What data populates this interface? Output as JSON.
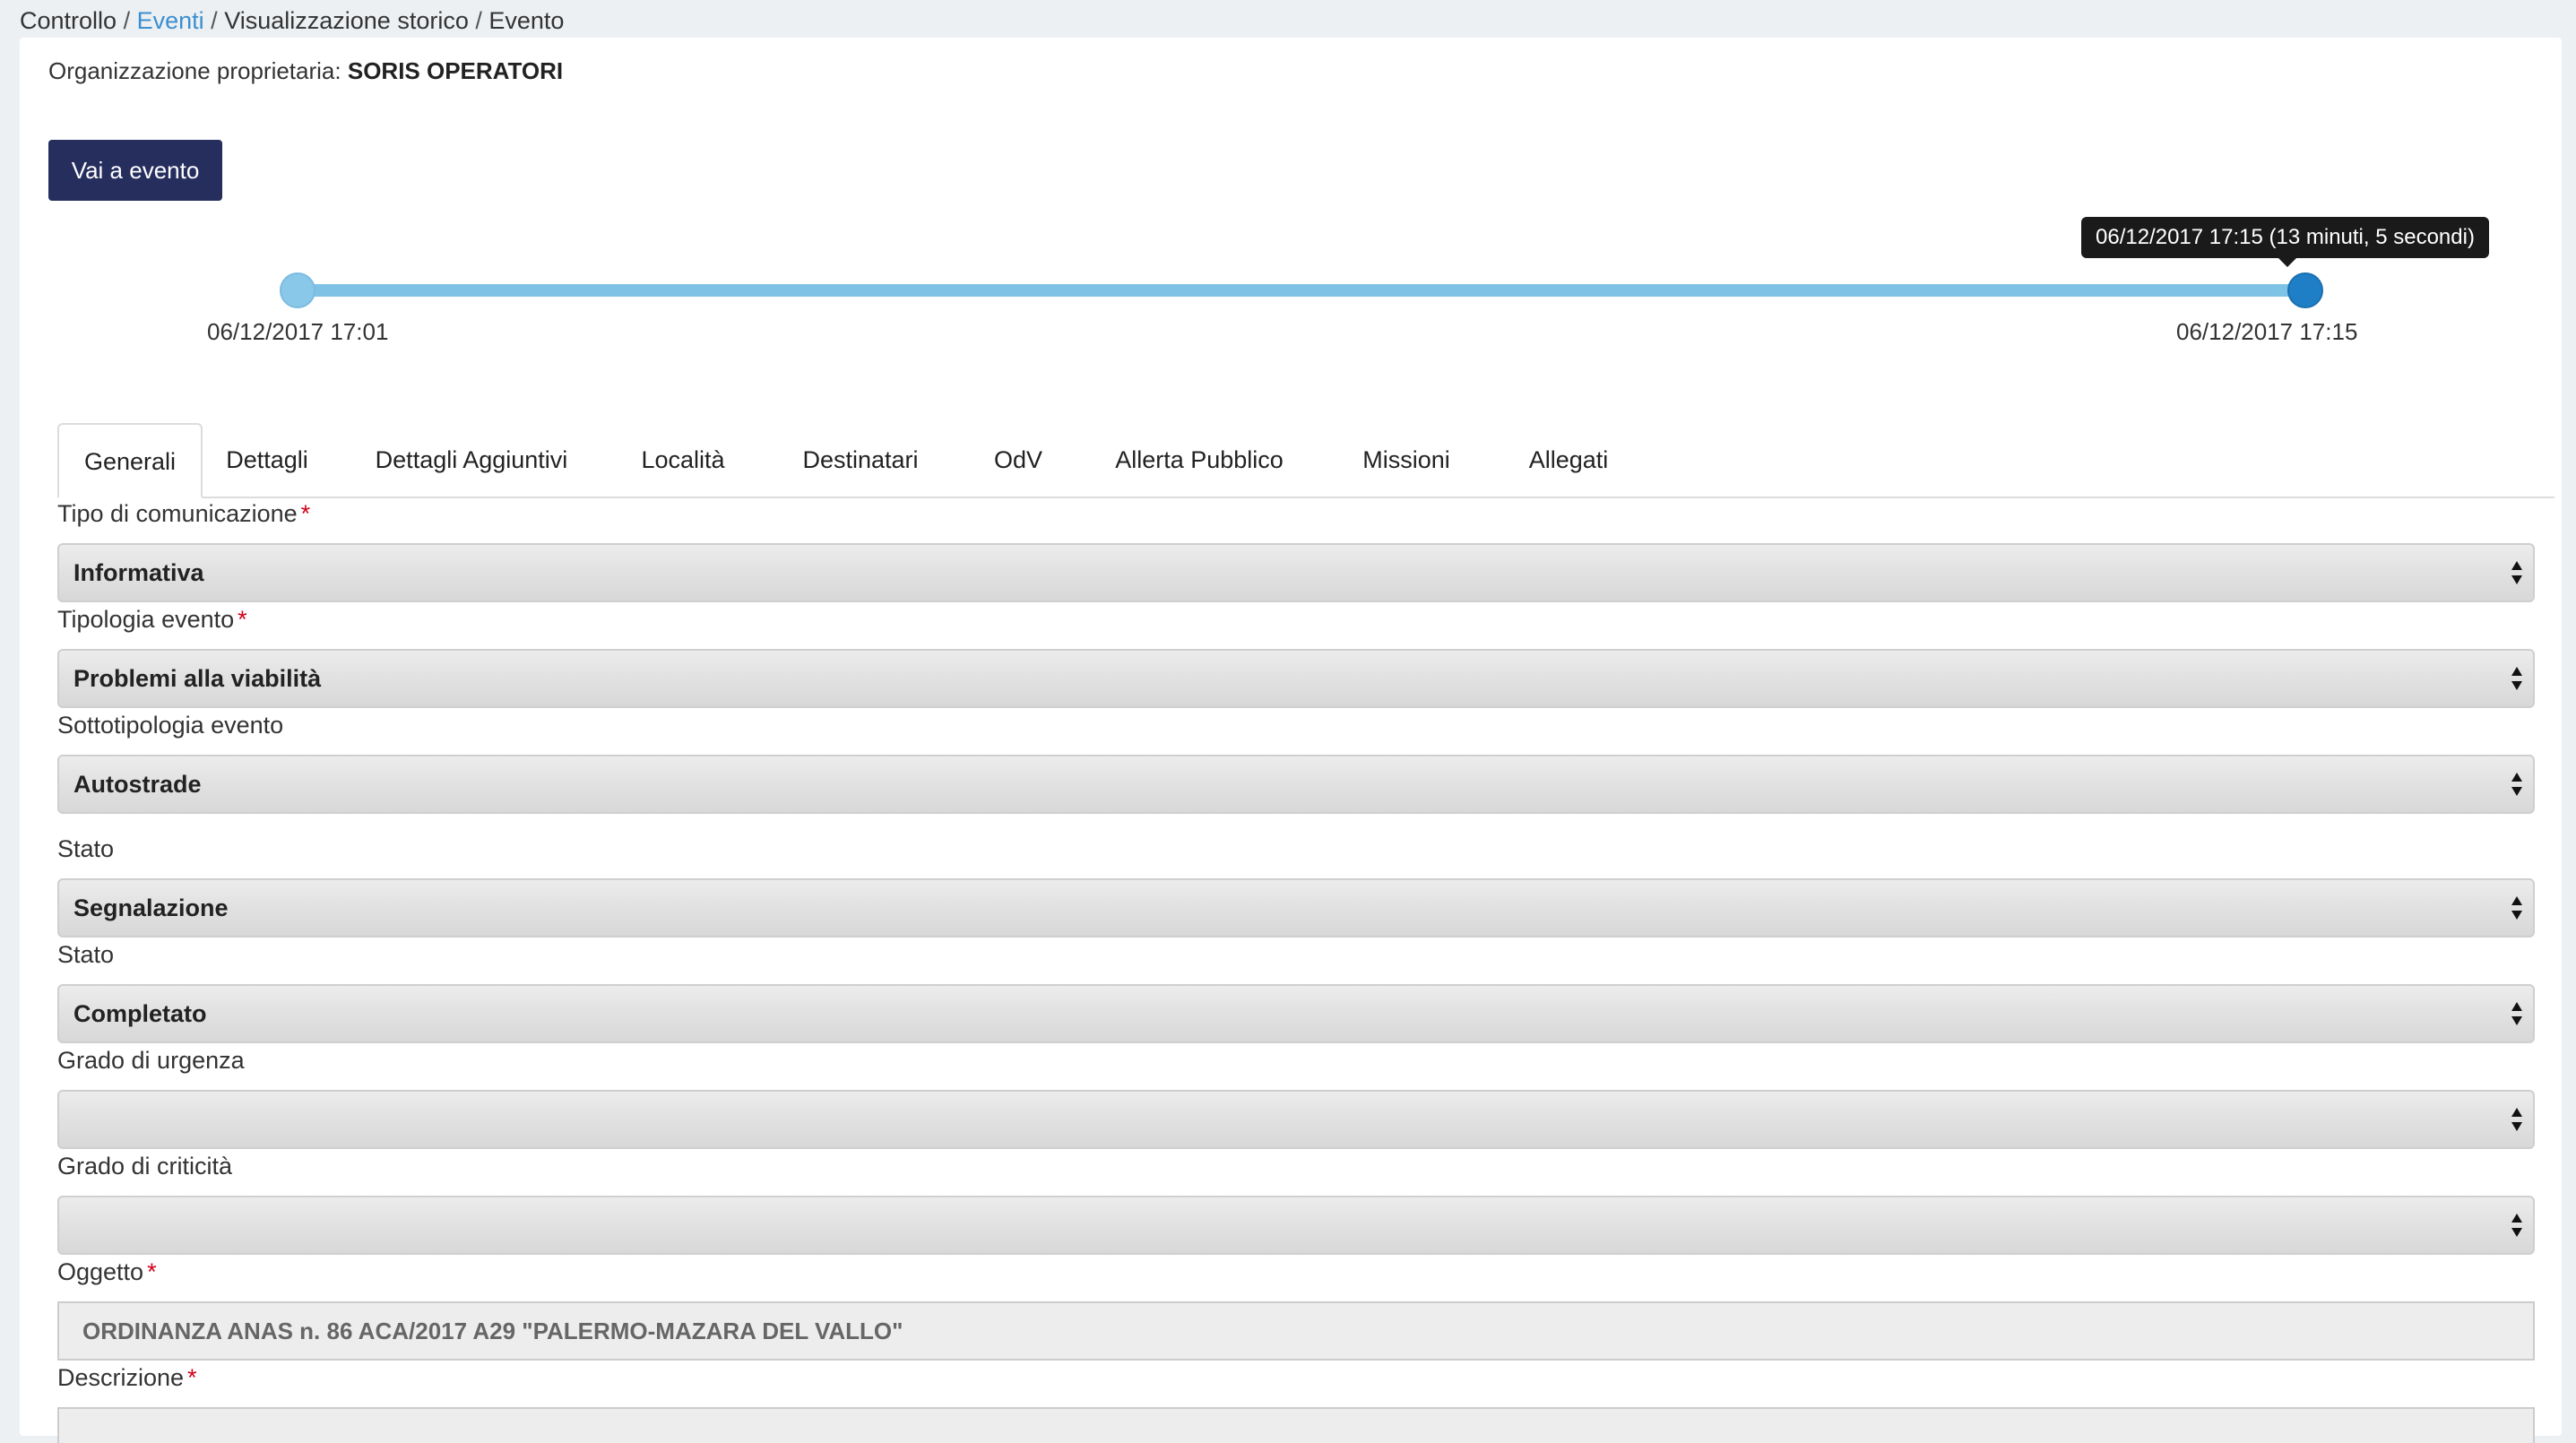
{
  "breadcrumb": {
    "item1": "Controllo",
    "item2": "Eventi",
    "item3": "Visualizzazione storico",
    "item4": "Evento",
    "separator": "/"
  },
  "owner": {
    "label": "Organizzazione proprietaria:",
    "value": "SORIS OPERATORI"
  },
  "goto_button": "Vai a evento",
  "timeline": {
    "start_label": "06/12/2017 17:01",
    "end_label": "06/12/2017 17:15",
    "tooltip": "06/12/2017 17:15 (13 minuti, 5 secondi)",
    "position": 1.0
  },
  "tabs": [
    {
      "label": "Generali"
    },
    {
      "label": "Dettagli"
    },
    {
      "label": "Dettagli Aggiuntivi"
    },
    {
      "label": "Località"
    },
    {
      "label": "Destinatari"
    },
    {
      "label": "OdV"
    },
    {
      "label": "Allerta Pubblico"
    },
    {
      "label": "Missioni"
    },
    {
      "label": "Allegati"
    }
  ],
  "required_mark": "*",
  "form": {
    "tipo_comunicazione": {
      "label": "Tipo di comunicazione",
      "value": "Informativa"
    },
    "tipologia_evento": {
      "label": "Tipologia evento",
      "value": "Problemi alla viabilità"
    },
    "sottotipologia_evento": {
      "label": "Sottotipologia evento",
      "value": "Autostrade"
    },
    "stato1": {
      "label": "Stato",
      "value": "Segnalazione"
    },
    "stato2": {
      "label": "Stato",
      "value": "Completato"
    },
    "grado_urgenza": {
      "label": "Grado di urgenza",
      "value": ""
    },
    "grado_criticita": {
      "label": "Grado di criticità",
      "value": ""
    },
    "oggetto": {
      "label": "Oggetto",
      "value": "ORDINANZA ANAS n. 86 ACA/2017 A29 \"PALERMO-MAZARA DEL VALLO\""
    },
    "descrizione": {
      "label": "Descrizione"
    }
  },
  "colors": {
    "button_bg": "#262e5e",
    "link": "#3a8fd0",
    "slider_track": "#7ec3e6",
    "slider_handle_active": "#1f7fc6",
    "required": "#d0021b"
  }
}
